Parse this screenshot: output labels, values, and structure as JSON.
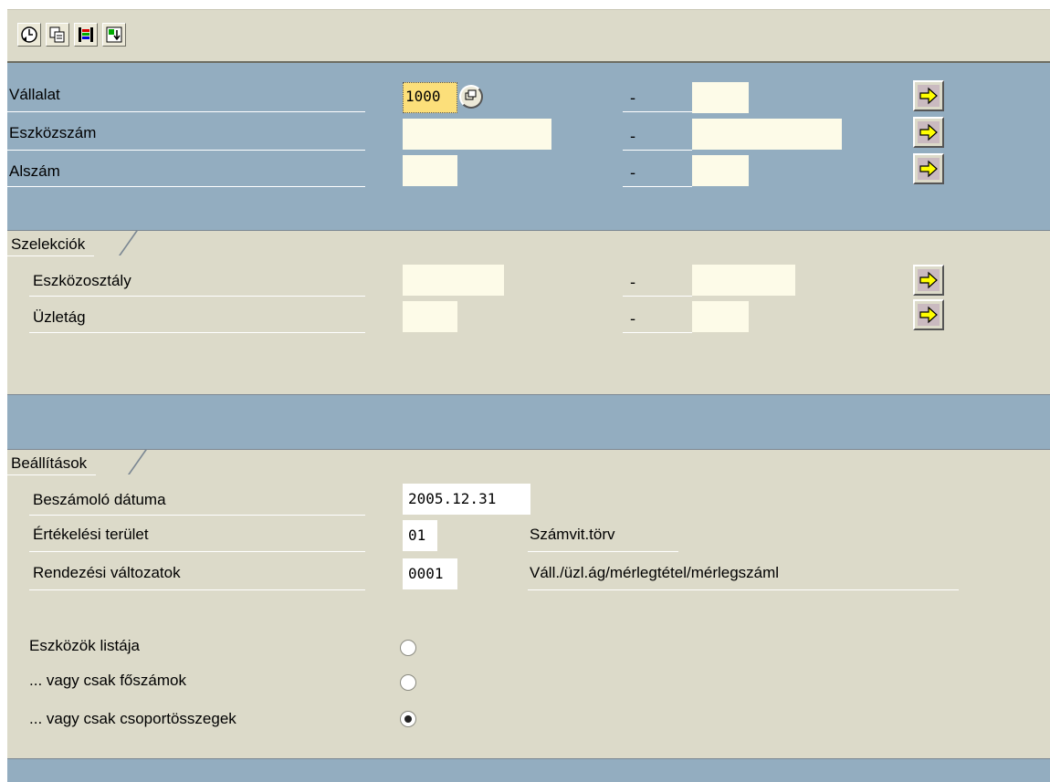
{
  "toolbar": {
    "buttons": [
      {
        "icon": "execute-clock-icon"
      },
      {
        "icon": "copy-icon"
      },
      {
        "icon": "color-bars-icon"
      },
      {
        "icon": "download-icon"
      }
    ]
  },
  "company_section": {
    "rows": [
      {
        "label": "Vállalat",
        "from": "1000",
        "to": "",
        "dash": "-"
      },
      {
        "label": "Eszközszám",
        "from": "",
        "to": "",
        "dash": "-"
      },
      {
        "label": "Alszám",
        "from": "",
        "to": "",
        "dash": "-"
      }
    ]
  },
  "selections": {
    "tab": "Szelekciók",
    "rows": [
      {
        "label": "Eszközosztály",
        "from": "",
        "to": "",
        "dash": "-"
      },
      {
        "label": "Üzletág",
        "from": "",
        "to": "",
        "dash": "-"
      }
    ]
  },
  "settings": {
    "tab": "Beállítások",
    "report_date": {
      "label": "Beszámoló dátuma",
      "value": "2005.12.31"
    },
    "valuation_area": {
      "label": "Értékelési terület",
      "value": "01",
      "description": "Számvit.törv"
    },
    "sort_variant": {
      "label": "Rendezési változatok",
      "value": "0001",
      "description": "Váll./üzl.ág/mérlegtétel/mérlegszáml"
    },
    "radios": [
      {
        "label": "Eszközök listája",
        "selected": false
      },
      {
        "label": "... vagy csak főszámok",
        "selected": false
      },
      {
        "label": "... vagy csak csoportösszegek",
        "selected": true
      }
    ]
  }
}
